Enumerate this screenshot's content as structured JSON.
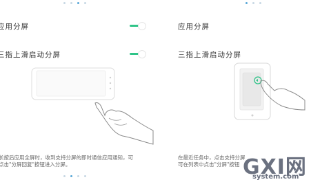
{
  "left_panel": {
    "row1_label": "应用分屏",
    "row2_label": "三指上滑启动分屏",
    "tip_line1": "长按后应用全屏时，收到支持分屏的即时通信应用通知，可",
    "tip_line2": "点击\"分屏回复\"按钮进入分屏。",
    "toggle1_on": true,
    "toggle2_on": true,
    "pager_top_active_index": 2,
    "pager_bottom_active_index": 1
  },
  "right_panel": {
    "row1_label": "应用分屏",
    "row2_label": "三指上滑启动分屏",
    "tip_line1": "在最近任务中，点击支持分屏",
    "tip_line2": "可在列表中点击\"分屏\"按钮"
  },
  "watermark": {
    "brand": "GXI网",
    "domain": "system.com"
  },
  "colors": {
    "toggle_on": "#2fc488",
    "pager_active": "#5aa8d8",
    "pager_inactive": "#c8d8e4"
  }
}
